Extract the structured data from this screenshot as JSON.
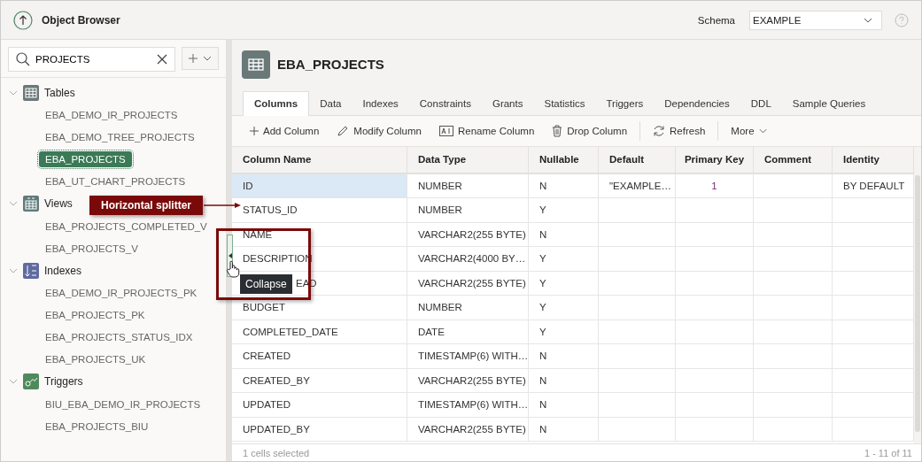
{
  "header": {
    "title": "Object Browser",
    "schema_label": "Schema",
    "schema_value": "EXAMPLE"
  },
  "search": {
    "value": "PROJECTS"
  },
  "tree": [
    {
      "label": "Tables",
      "kind": "tables",
      "expanded": true,
      "children": [
        {
          "label": "EBA_DEMO_IR_PROJECTS",
          "selected": false
        },
        {
          "label": "EBA_DEMO_TREE_PROJECTS",
          "selected": false
        },
        {
          "label": "EBA_PROJECTS",
          "selected": true
        },
        {
          "label": "EBA_UT_CHART_PROJECTS",
          "selected": false
        }
      ]
    },
    {
      "label": "Views",
      "kind": "views",
      "expanded": true,
      "children": [
        {
          "label": "EBA_PROJECTS_COMPLETED_V",
          "selected": false
        },
        {
          "label": "EBA_PROJECTS_V",
          "selected": false
        }
      ]
    },
    {
      "label": "Indexes",
      "kind": "indexes",
      "expanded": true,
      "children": [
        {
          "label": "EBA_DEMO_IR_PROJECTS_PK",
          "selected": false
        },
        {
          "label": "EBA_PROJECTS_PK",
          "selected": false
        },
        {
          "label": "EBA_PROJECTS_STATUS_IDX",
          "selected": false
        },
        {
          "label": "EBA_PROJECTS_UK",
          "selected": false
        }
      ]
    },
    {
      "label": "Triggers",
      "kind": "triggers",
      "expanded": true,
      "children": [
        {
          "label": "BIU_EBA_DEMO_IR_PROJECTS",
          "selected": false
        },
        {
          "label": "EBA_PROJECTS_BIU",
          "selected": false
        }
      ]
    }
  ],
  "object": {
    "title": "EBA_PROJECTS"
  },
  "tabs": [
    {
      "label": "Columns",
      "selected": true
    },
    {
      "label": "Data",
      "selected": false
    },
    {
      "label": "Indexes",
      "selected": false
    },
    {
      "label": "Constraints",
      "selected": false
    },
    {
      "label": "Grants",
      "selected": false
    },
    {
      "label": "Statistics",
      "selected": false
    },
    {
      "label": "Triggers",
      "selected": false
    },
    {
      "label": "Dependencies",
      "selected": false
    },
    {
      "label": "DDL",
      "selected": false
    },
    {
      "label": "Sample Queries",
      "selected": false
    }
  ],
  "toolbar": [
    {
      "label": "Add Column",
      "kind": "add"
    },
    {
      "label": "Modify Column",
      "kind": "modify"
    },
    {
      "label": "Rename Column",
      "kind": "rename"
    },
    {
      "label": "Drop Column",
      "kind": "drop"
    },
    {
      "label": "Refresh",
      "kind": "refresh"
    },
    {
      "label": "More",
      "kind": "more"
    }
  ],
  "table": {
    "columns": [
      "Column Name",
      "Data Type",
      "Nullable",
      "Default",
      "Primary Key",
      "Comment",
      "Identity"
    ],
    "rows": [
      {
        "cells": [
          "ID",
          "NUMBER",
          "N",
          "\"EXAMPLE…",
          "1",
          "",
          "BY DEFAULT"
        ],
        "selected": true
      },
      {
        "cells": [
          "STATUS_ID",
          "NUMBER",
          "Y",
          "",
          "",
          "",
          ""
        ],
        "selected": false
      },
      {
        "cells": [
          "NAME",
          "VARCHAR2(255 BYTE)",
          "N",
          "",
          "",
          "",
          ""
        ],
        "selected": false
      },
      {
        "cells": [
          "DESCRIPTION",
          "VARCHAR2(4000 BY…",
          "Y",
          "",
          "",
          "",
          ""
        ],
        "selected": false
      },
      {
        "cells": [
          "EAD",
          "VARCHAR2(255 BYTE)",
          "Y",
          "",
          "",
          "",
          ""
        ],
        "selected": false,
        "covered": true
      },
      {
        "cells": [
          "BUDGET",
          "NUMBER",
          "Y",
          "",
          "",
          "",
          ""
        ],
        "selected": false
      },
      {
        "cells": [
          "COMPLETED_DATE",
          "DATE",
          "Y",
          "",
          "",
          "",
          ""
        ],
        "selected": false
      },
      {
        "cells": [
          "CREATED",
          "TIMESTAMP(6) WITH…",
          "N",
          "",
          "",
          "",
          ""
        ],
        "selected": false
      },
      {
        "cells": [
          "CREATED_BY",
          "VARCHAR2(255 BYTE)",
          "N",
          "",
          "",
          "",
          ""
        ],
        "selected": false
      },
      {
        "cells": [
          "UPDATED",
          "TIMESTAMP(6) WITH…",
          "N",
          "",
          "",
          "",
          ""
        ],
        "selected": false
      },
      {
        "cells": [
          "UPDATED_BY",
          "VARCHAR2(255 BYTE)",
          "N",
          "",
          "",
          "",
          ""
        ],
        "selected": false
      }
    ]
  },
  "status_bar": {
    "selection": "1 cells selected",
    "range": "1 - 11 of 11"
  },
  "callout": {
    "label": "Horizontal splitter"
  },
  "tooltip": {
    "label": "Collapse"
  }
}
